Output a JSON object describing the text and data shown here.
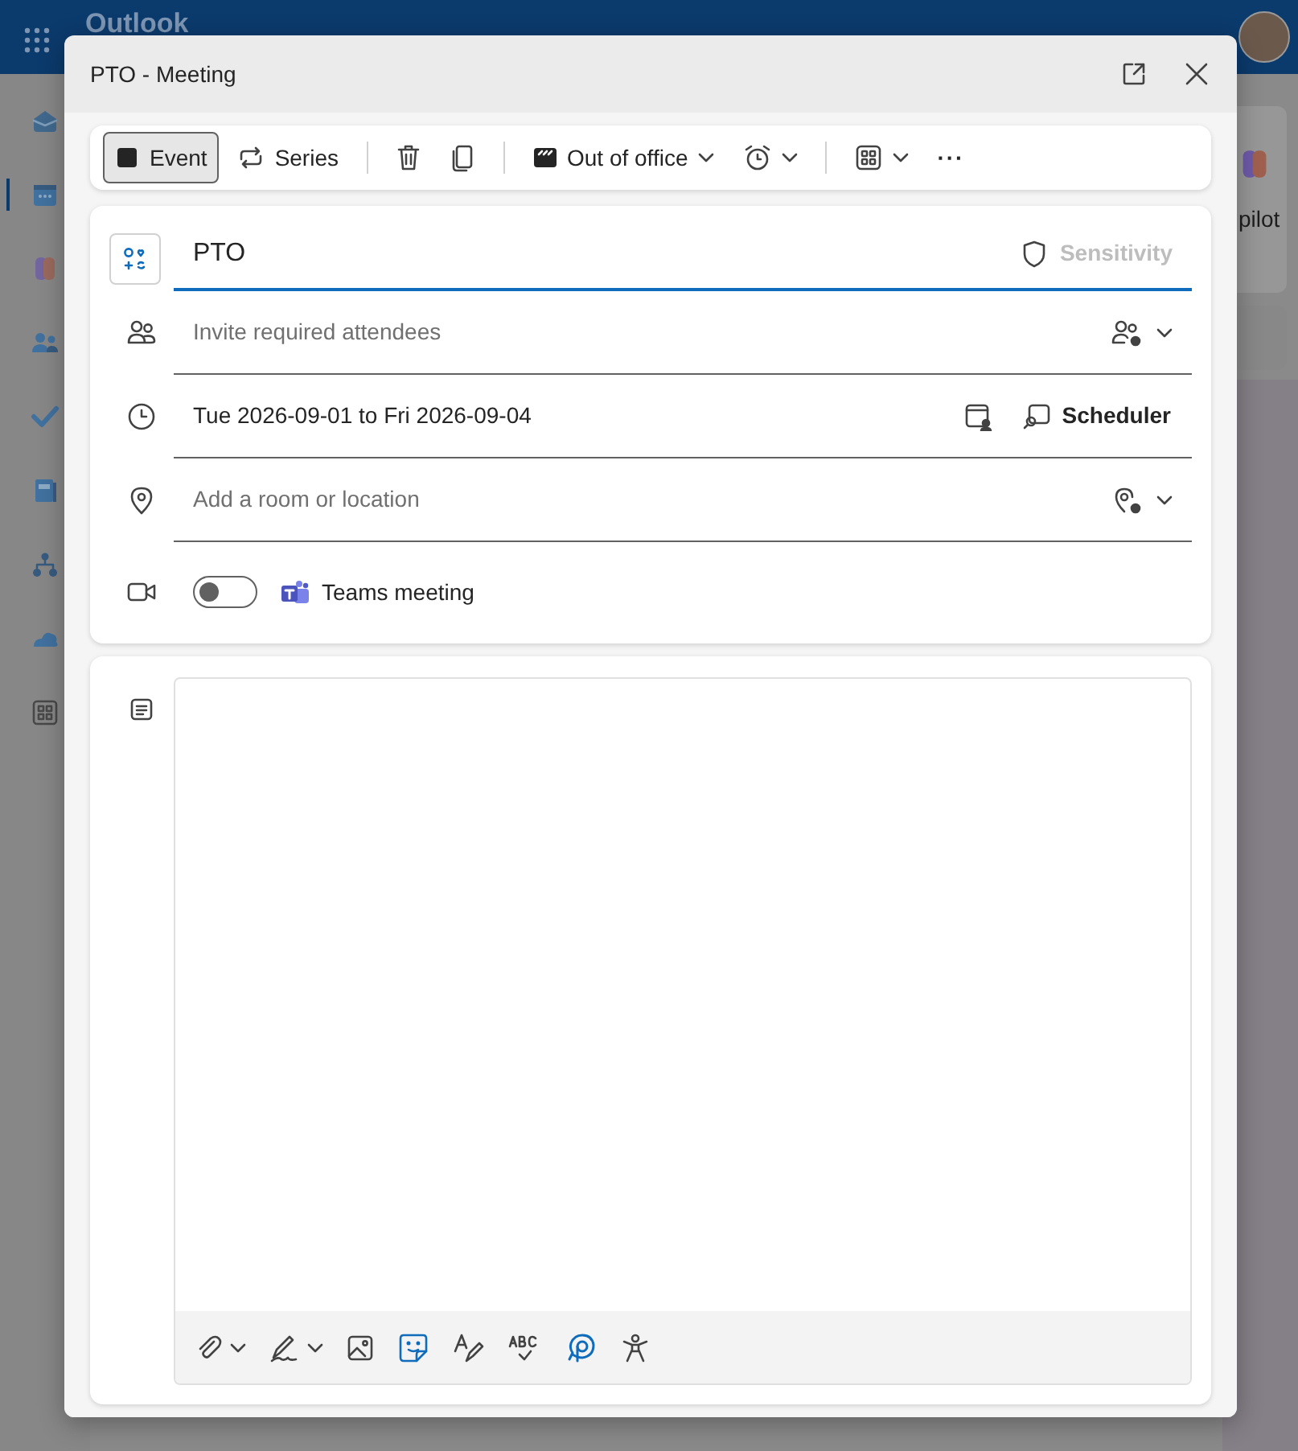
{
  "app": {
    "title": "Outlook",
    "copilot_label": "pilot",
    "rail": [
      {
        "selected": false
      },
      {
        "selected": true
      },
      {
        "selected": false
      },
      {
        "selected": false
      },
      {
        "selected": false
      },
      {
        "selected": false
      },
      {
        "selected": false
      },
      {
        "selected": false
      },
      {
        "selected": false
      }
    ]
  },
  "dialog": {
    "title": "PTO - Meeting",
    "toolbar": {
      "event": {
        "label": "Event",
        "selected": true
      },
      "series": {
        "label": "Series",
        "selected": false
      },
      "show_as": "Out of office",
      "more": "···"
    },
    "subject": {
      "value": "PTO"
    },
    "sensitivity": "Sensitivity",
    "attendees": {
      "placeholder": "Invite required attendees"
    },
    "date": "Tue 2026-09-01 to Fri 2026-09-04",
    "scheduler": "Scheduler",
    "location": {
      "placeholder": "Add a room or location"
    },
    "teams": {
      "on": false,
      "label": "Teams meeting"
    }
  }
}
